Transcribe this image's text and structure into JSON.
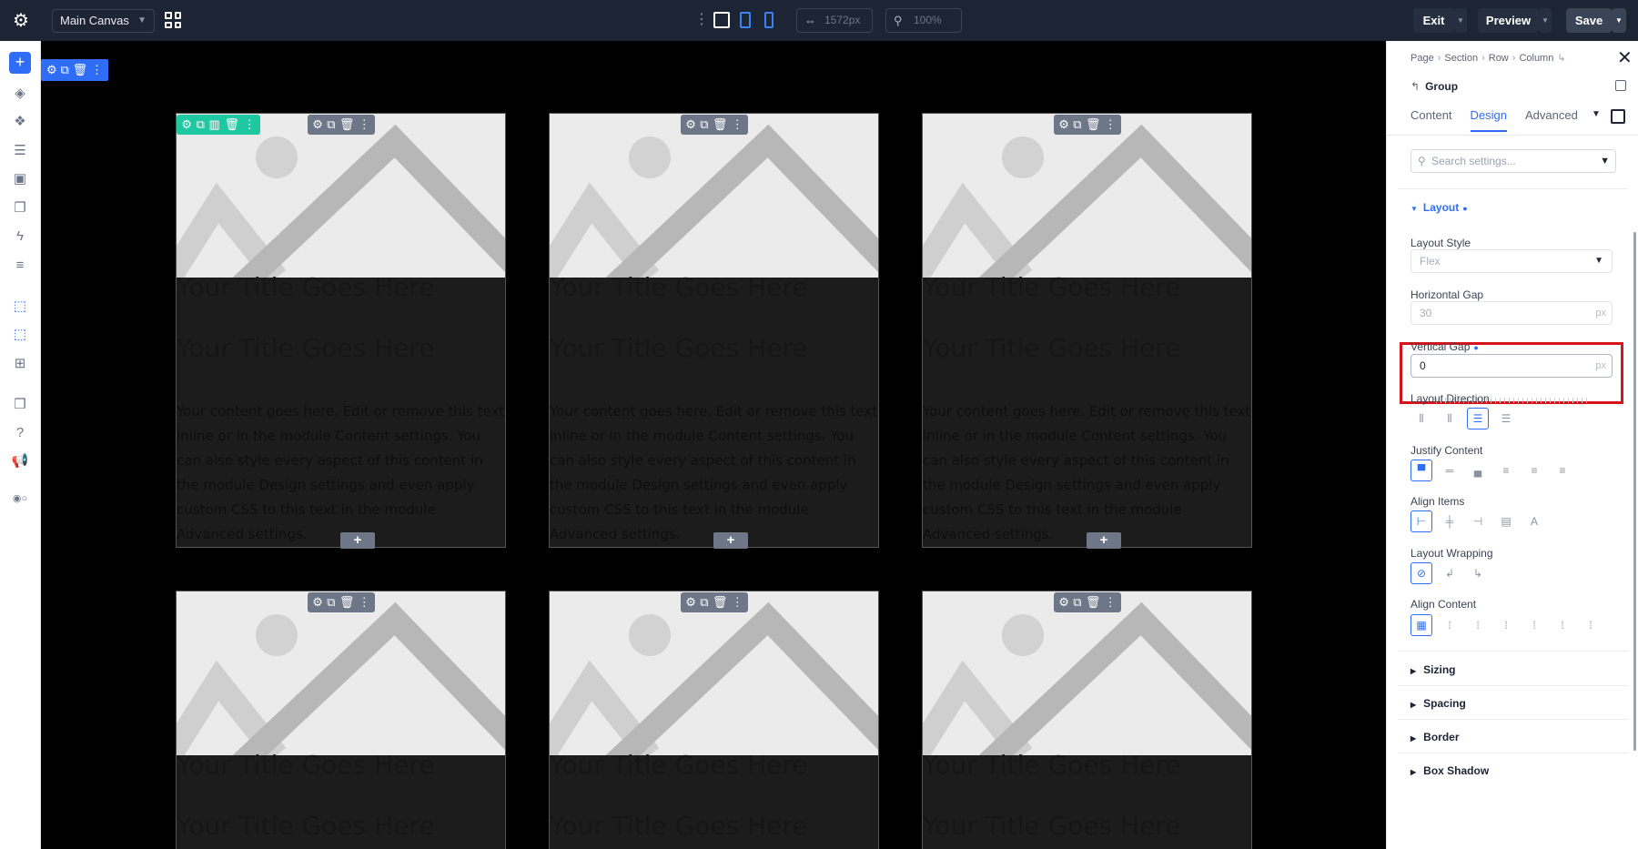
{
  "topbar": {
    "canvas_select": "Main Canvas",
    "width_value": "1572px",
    "zoom_value": "100%",
    "exit_label": "Exit",
    "preview_label": "Preview",
    "save_label": "Save"
  },
  "canvas": {
    "cards": [
      {
        "title1": "Your Title Goes Here",
        "title2": "Your Title Goes Here",
        "body": "Your content goes here. Edit or remove this text inline or in the module Content settings. You can also style every aspect of this content in the module Design settings and even apply custom CSS to this text in the module Advanced settings."
      },
      {
        "title1": "Your Title Goes Here",
        "title2": "Your Title Goes Here",
        "body": "Your content goes here. Edit or remove this text inline or in the module Content settings. You can also style every aspect of this content in the module Design settings and even apply custom CSS to this text in the module Advanced settings."
      },
      {
        "title1": "Your Title Goes Here",
        "title2": "Your Title Goes Here",
        "body": "Your content goes here. Edit or remove this text inline or in the module Content settings. You can also style every aspect of this content in the module Design settings and even apply custom CSS to this text in the module Advanced settings."
      },
      {
        "title1": "Your Title Goes Here",
        "title2": "Your Title Goes Here"
      },
      {
        "title1": "Your Title Goes Here",
        "title2": "Your Title Goes Here"
      },
      {
        "title1": "Your Title Goes Here",
        "title2": "Your Title Goes Here"
      }
    ]
  },
  "panel": {
    "breadcrumb": [
      "Page",
      "Section",
      "Row",
      "Column"
    ],
    "group_label": "Group",
    "tabs": [
      "Content",
      "Design",
      "Advanced"
    ],
    "active_tab": "Design",
    "search_placeholder": "Search settings...",
    "layout": {
      "heading": "Layout",
      "style_label": "Layout Style",
      "style_value": "Flex",
      "hgap_label": "Horizontal Gap",
      "hgap_value": "30",
      "hgap_unit": "px",
      "vgap_label": "Vertical Gap",
      "vgap_value": "0",
      "vgap_unit": "px",
      "direction_label": "Layout Direction",
      "justify_label": "Justify Content",
      "align_items_label": "Align Items",
      "wrapping_label": "Layout Wrapping",
      "align_content_label": "Align Content"
    },
    "sections": [
      "Sizing",
      "Spacing",
      "Border",
      "Box Shadow"
    ]
  },
  "colors": {
    "accent": "#2f6df6",
    "topbar_bg": "#1d2535",
    "highlight": "#d6131b",
    "module_tools": "#1ec8a0"
  }
}
